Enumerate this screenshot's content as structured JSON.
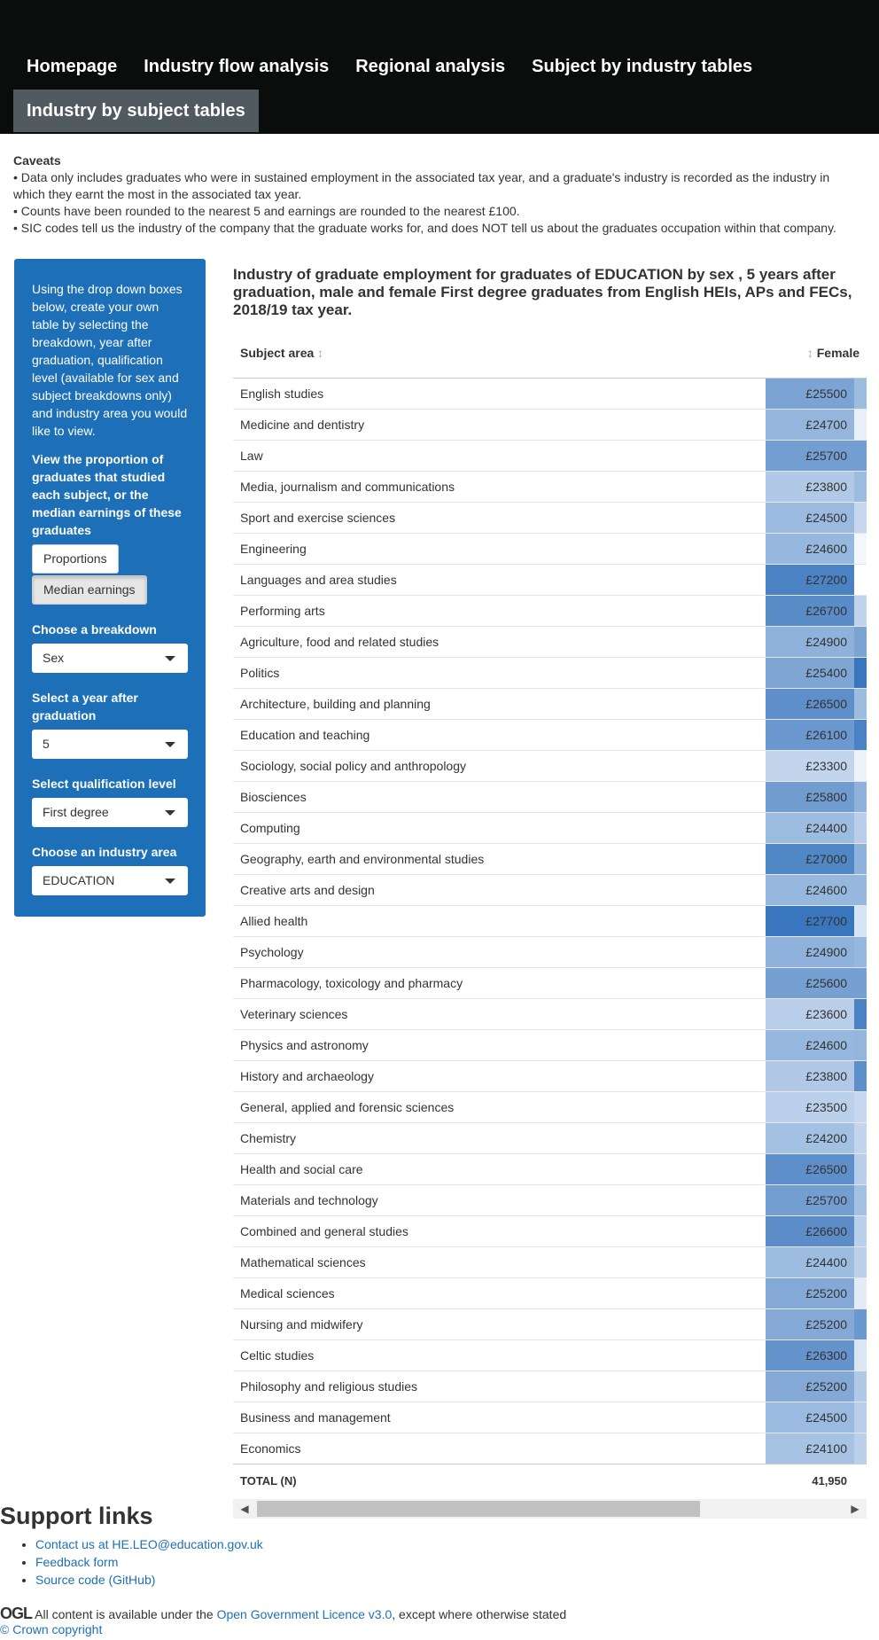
{
  "nav": {
    "items": [
      "Homepage",
      "Industry flow analysis",
      "Regional analysis",
      "Subject by industry tables"
    ],
    "active": "Industry by subject tables"
  },
  "caveats": {
    "title": "Caveats",
    "lines": [
      "• Data only includes graduates who were in sustained employment in the associated tax year, and a graduate's industry is recorded as the industry in which they earnt the most in the associated tax year.",
      "• Counts have been rounded to the nearest 5 and earnings are rounded to the nearest £100.",
      "• SIC codes tell us the industry of the company that the graduate works for, and does NOT tell us about the graduates occupation within that company."
    ]
  },
  "sidebar": {
    "intro": "Using the drop down boxes below, create your own table by selecting the breakdown, year after graduation, qualification level (available for sex and subject breakdowns only) and industry area you would like to view.",
    "proportion_question": "View the proportion of graduates that studied each subject, or the median earnings of these graduates",
    "btn_proportions": "Proportions",
    "btn_median": "Median earnings",
    "breakdown_label": "Choose a breakdown",
    "breakdown_value": "Sex",
    "year_label": "Select a year after graduation",
    "year_value": "5",
    "qual_label": "Select qualification level",
    "qual_value": "First degree",
    "industry_label": "Choose an industry area",
    "industry_value": "EDUCATION"
  },
  "table": {
    "title": "Industry of graduate employment for graduates of EDUCATION by sex , 5 years after graduation, male and female First degree graduates from English HEIs, APs and FECs, 2018/19 tax year.",
    "col_subject": "Subject area",
    "col_female": "Female",
    "sort_icon": "↕",
    "rows": [
      {
        "subject": "English studies",
        "female": "£25500",
        "color": "#7ba3d3",
        "edge": "#9dbde0"
      },
      {
        "subject": "Medicine and dentistry",
        "female": "£24700",
        "color": "#94b6dd",
        "edge": "#e8eff8"
      },
      {
        "subject": "Law",
        "female": "£25700",
        "color": "#739ed1",
        "edge": "#739ed1"
      },
      {
        "subject": "Media, journalism and communications",
        "female": "£23800",
        "color": "#b1c9e7",
        "edge": "#9dbde0"
      },
      {
        "subject": "Sport and exercise sciences",
        "female": "£24500",
        "color": "#9abadf",
        "edge": "#c7d8ee"
      },
      {
        "subject": "Engineering",
        "female": "£24600",
        "color": "#97b8de",
        "edge": "#f3f7fb"
      },
      {
        "subject": "Languages and area studies",
        "female": "£27200",
        "color": "#4b82c3",
        "edge": "#ffffff"
      },
      {
        "subject": "Performing arts",
        "female": "£26700",
        "color": "#5a8cc8",
        "edge": "#bfd3eb"
      },
      {
        "subject": "Agriculture, food and related studies",
        "female": "£24900",
        "color": "#8eb2db",
        "edge": "#7ba3d3"
      },
      {
        "subject": "Politics",
        "female": "£25400",
        "color": "#7ea5d4",
        "edge": "#3a76bd"
      },
      {
        "subject": "Architecture, building and planning",
        "female": "£26500",
        "color": "#5f8fca",
        "edge": "#9dbde0"
      },
      {
        "subject": "Education and teaching",
        "female": "£26100",
        "color": "#6b98ce",
        "edge": "#4b82c3"
      },
      {
        "subject": "Sociology, social policy and anthropology",
        "female": "£23300",
        "color": "#c2d5ec",
        "edge": "#eef3f9"
      },
      {
        "subject": "Biosciences",
        "female": "£25800",
        "color": "#709cd0",
        "edge": "#8eb2db"
      },
      {
        "subject": "Computing",
        "female": "£24400",
        "color": "#9dbde0",
        "edge": "#b8cee9"
      },
      {
        "subject": "Geography, earth and environmental studies",
        "female": "£27000",
        "color": "#5087c5",
        "edge": "#8eb2db"
      },
      {
        "subject": "Creative arts and design",
        "female": "£24600",
        "color": "#97b8de",
        "edge": "#97b8de"
      },
      {
        "subject": "Allied health",
        "female": "£27700",
        "color": "#3a76bd",
        "edge": "#d7e4f3"
      },
      {
        "subject": "Psychology",
        "female": "£24900",
        "color": "#8eb2db",
        "edge": "#97b8de"
      },
      {
        "subject": "Pharmacology, toxicology and pharmacy",
        "female": "£25600",
        "color": "#76a0d2",
        "edge": "#76a0d2"
      },
      {
        "subject": "Veterinary sciences",
        "female": "£23600",
        "color": "#b8cee9",
        "edge": "#4b82c3"
      },
      {
        "subject": "Physics and astronomy",
        "female": "£24600",
        "color": "#97b8de",
        "edge": "#94b6dd"
      },
      {
        "subject": "History and archaeology",
        "female": "£23800",
        "color": "#b1c9e7",
        "edge": "#5f8fca"
      },
      {
        "subject": "General, applied and forensic sciences",
        "female": "£23500",
        "color": "#bbd0ea",
        "edge": "#c7d8ee"
      },
      {
        "subject": "Chemistry",
        "female": "£24200",
        "color": "#a3c1e2",
        "edge": "#c2d5ec"
      },
      {
        "subject": "Health and social care",
        "female": "£26500",
        "color": "#5f8fca",
        "edge": "#b8cee9"
      },
      {
        "subject": "Materials and technology",
        "female": "£25700",
        "color": "#739ed1",
        "edge": "#a3c1e2"
      },
      {
        "subject": "Combined and general studies",
        "female": "£26600",
        "color": "#5d8dc9",
        "edge": "#bbd0ea"
      },
      {
        "subject": "Mathematical sciences",
        "female": "£24400",
        "color": "#9dbde0",
        "edge": "#bbd0ea"
      },
      {
        "subject": "Medical sciences",
        "female": "£25200",
        "color": "#84a9d6",
        "edge": "#e3ecf6"
      },
      {
        "subject": "Nursing and midwifery",
        "female": "£25200",
        "color": "#84a9d6",
        "edge": "#6b98ce"
      },
      {
        "subject": "Celtic studies",
        "female": "£26300",
        "color": "#6593cc",
        "edge": "#dbe6f3"
      },
      {
        "subject": "Philosophy and religious studies",
        "female": "£25200",
        "color": "#84a9d6",
        "edge": "#b1c9e7"
      },
      {
        "subject": "Business and management",
        "female": "£24500",
        "color": "#9abadf",
        "edge": "#b8cee9"
      },
      {
        "subject": "Economics",
        "female": "£24100",
        "color": "#a6c3e3",
        "edge": "#bbd0ea"
      }
    ],
    "total_label": "TOTAL (N)",
    "total_value": "41,950"
  },
  "support": {
    "title": "Support links",
    "links": [
      "Contact us at HE.LEO@education.gov.uk",
      "Feedback form",
      "Source code (GitHub)"
    ]
  },
  "footer": {
    "ogl": "OGL",
    "licence_prefix": "All content is available under the ",
    "licence_link": "Open Government Licence v3.0",
    "licence_suffix": ", except where otherwise stated",
    "copyright": "© Crown copyright"
  }
}
